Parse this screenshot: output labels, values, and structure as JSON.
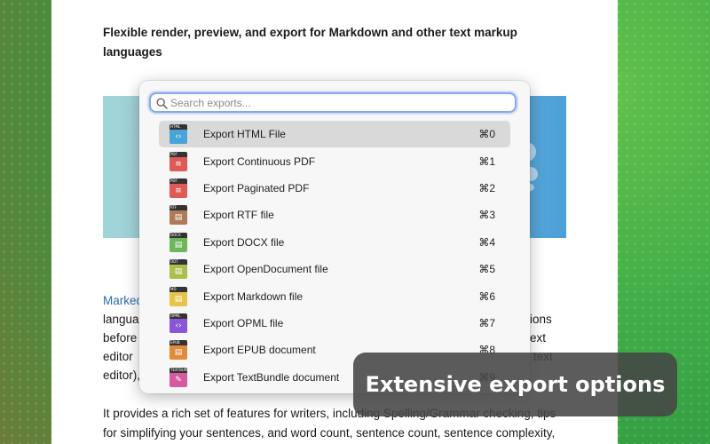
{
  "background": {
    "accent": "#3fab48"
  },
  "document": {
    "heading": "Flexible render, preview, and export for Markdown and other text markup languages",
    "para_left": [
      "Marked",
      "langua",
      "before",
      "editor",
      "editor),"
    ],
    "para_right": [
      "ions",
      "ext",
      "text"
    ],
    "para2": "It provides a rich set of features for writers, including Spelling/Grammar checking, tips for simplifying your sentences, and word count, sentence count, sentence complexity,"
  },
  "export_panel": {
    "search": {
      "placeholder": "Search exports..."
    },
    "items": [
      {
        "label": "Export HTML File",
        "shortcut": "⌘0",
        "icon": "html-file-icon",
        "badge": "HTML",
        "color": "#4aa3d9",
        "glyph": "‹›",
        "selected": true
      },
      {
        "label": "Export Continuous PDF",
        "shortcut": "⌘1",
        "icon": "pdf-file-icon",
        "badge": "PDF",
        "color": "#e05a55",
        "glyph": "≡"
      },
      {
        "label": "Export Paginated PDF",
        "shortcut": "⌘2",
        "icon": "pdf-file-icon",
        "badge": "PDF",
        "color": "#e05a55",
        "glyph": "≡"
      },
      {
        "label": "Export RTF file",
        "shortcut": "⌘3",
        "icon": "rtf-file-icon",
        "badge": "RTF",
        "color": "#b07a5a",
        "glyph": "▤"
      },
      {
        "label": "Export DOCX file",
        "shortcut": "⌘4",
        "icon": "docx-file-icon",
        "badge": "DOCX",
        "color": "#6db85a",
        "glyph": "▤"
      },
      {
        "label": "Export OpenDocument file",
        "shortcut": "⌘5",
        "icon": "odt-file-icon",
        "badge": "ODT",
        "color": "#a9c04a",
        "glyph": "▤"
      },
      {
        "label": "Export Markdown file",
        "shortcut": "⌘6",
        "icon": "markdown-file-icon",
        "badge": "MD",
        "color": "#e8c34a",
        "glyph": "▤"
      },
      {
        "label": "Export OPML file",
        "shortcut": "⌘7",
        "icon": "opml-file-icon",
        "badge": "OPML",
        "color": "#8a55d6",
        "glyph": "‹›"
      },
      {
        "label": "Export EPUB document",
        "shortcut": "⌘8",
        "icon": "epub-file-icon",
        "badge": "EPUB",
        "color": "#e08a3a",
        "glyph": "▤"
      },
      {
        "label": "Export TextBundle document",
        "shortcut": "⌘9",
        "icon": "textbundle-file-icon",
        "badge": "TEXTBUNDLE",
        "color": "#d65aa0",
        "glyph": "✎"
      }
    ]
  },
  "banner": {
    "text": "Extensive export options"
  }
}
